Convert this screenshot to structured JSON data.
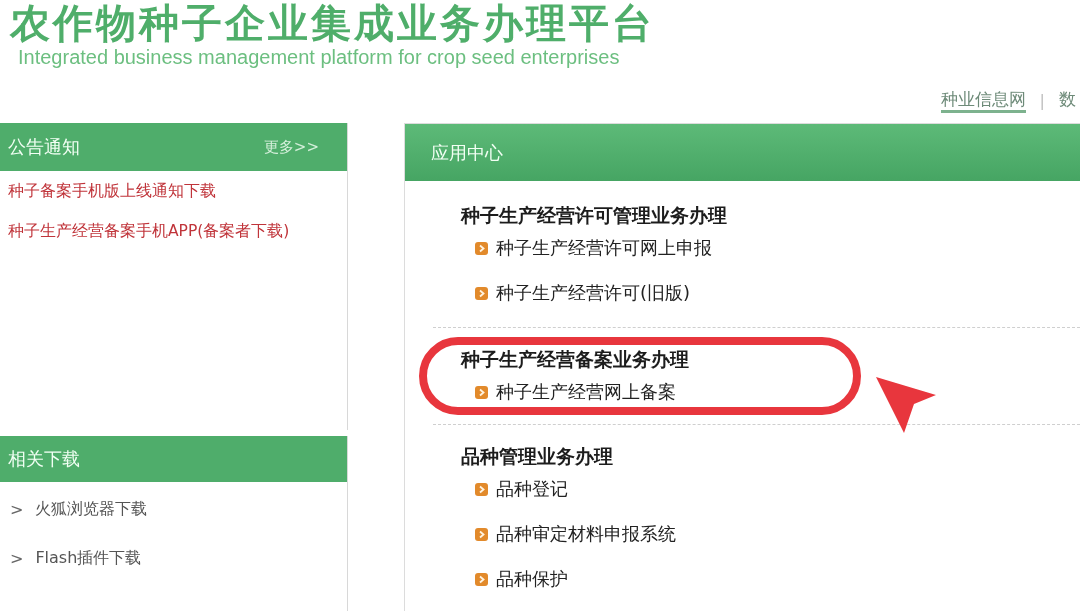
{
  "header": {
    "title": "农作物种子企业集成业务办理平台",
    "subtitle": "Integrated business management platform for crop seed enterprises"
  },
  "top_nav": {
    "links": [
      {
        "label": "种业信息网",
        "selected": true
      },
      {
        "label": "数",
        "selected": false
      }
    ],
    "separator": "|"
  },
  "announcements": {
    "title": "公告通知",
    "more": "更多>>",
    "items": [
      "种子备案手机版上线通知下载",
      "种子生产经营备案手机APP(备案者下载)"
    ]
  },
  "downloads": {
    "title": "相关下载",
    "items": [
      {
        "marker": ">",
        "label": "火狐浏览器下载"
      },
      {
        "marker": ">",
        "label": "Flash插件下载"
      }
    ]
  },
  "app_center": {
    "title": "应用中心",
    "sections": [
      {
        "heading": "种子生产经营许可管理业务办理",
        "highlighted": false,
        "items": [
          "种子生产经营许可网上申报",
          "种子生产经营许可(旧版)"
        ]
      },
      {
        "heading": "种子生产经营备案业务办理",
        "highlighted": true,
        "items": [
          "种子生产经营网上备案"
        ]
      },
      {
        "heading": "品种管理业务办理",
        "highlighted": false,
        "items": [
          "品种登记",
          "品种审定材料申报系统",
          "品种保护"
        ]
      }
    ]
  }
}
